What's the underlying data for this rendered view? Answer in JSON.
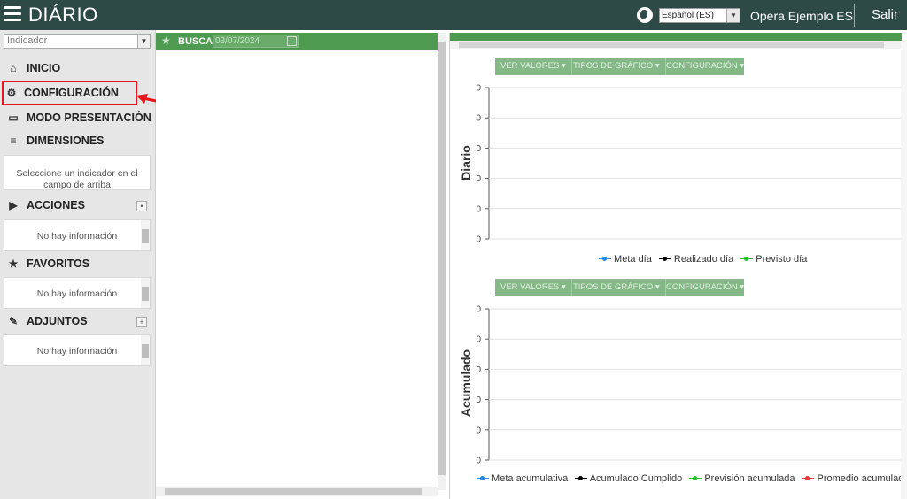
{
  "topbar": {
    "title": "DIÁRIO",
    "language": "Español (ES)",
    "user": "Opera Ejemplo ES",
    "logout": "Salir"
  },
  "sidebar": {
    "indicator_placeholder": "Indicador",
    "menu": {
      "inicio": "INICIO",
      "configuracion": "CONFIGURACIÓN",
      "modo_presentacion": "MODO PRESENTACIÓN",
      "dimensiones": "DIMENSIONES",
      "acciones": "ACCIONES",
      "favoritos": "FAVORITOS",
      "adjuntos": "ADJUNTOS"
    },
    "dimensiones_hint": "Seleccione un indicador en el campo de arriba",
    "no_info": "No hay información"
  },
  "middle": {
    "search_label": "BUSCA",
    "date": "03/07/2024"
  },
  "chart_toolbar": {
    "ver_valores": "VER VALORES",
    "tipos_grafico": "TIPOS DE GRÁFICO",
    "configuracion": "CONFIGURACIÓN"
  },
  "colors": {
    "topbar": "#2d4a47",
    "accent_green": "#4d9a50",
    "highlight": "#e8141b",
    "series_blue": "#1e88e5",
    "series_black": "#000000",
    "series_green": "#22c322",
    "series_red": "#e53935"
  },
  "chart_data": [
    {
      "type": "line",
      "ylabel": "Diario",
      "y_ticks": [
        "0",
        "0",
        "0",
        "0",
        "0",
        "0"
      ],
      "grid": true,
      "legend_position": "bottom",
      "series": [
        {
          "name": "Meta día",
          "color": "#1e88e5",
          "values": []
        },
        {
          "name": "Realizado día",
          "color": "#000000",
          "values": []
        },
        {
          "name": "Previsto día",
          "color": "#22c322",
          "values": []
        }
      ]
    },
    {
      "type": "line",
      "ylabel": "Acumulado",
      "y_ticks": [
        "0",
        "0",
        "0",
        "0",
        "0",
        "0"
      ],
      "grid": true,
      "legend_position": "bottom",
      "series": [
        {
          "name": "Meta acumulativa",
          "color": "#1e88e5",
          "values": []
        },
        {
          "name": "Acumulado Cumplido",
          "color": "#000000",
          "values": []
        },
        {
          "name": "Previsión acumulada",
          "color": "#22c322",
          "values": []
        },
        {
          "name": "Promedio acumulado realizado",
          "color": "#e53935",
          "values": []
        }
      ]
    }
  ]
}
